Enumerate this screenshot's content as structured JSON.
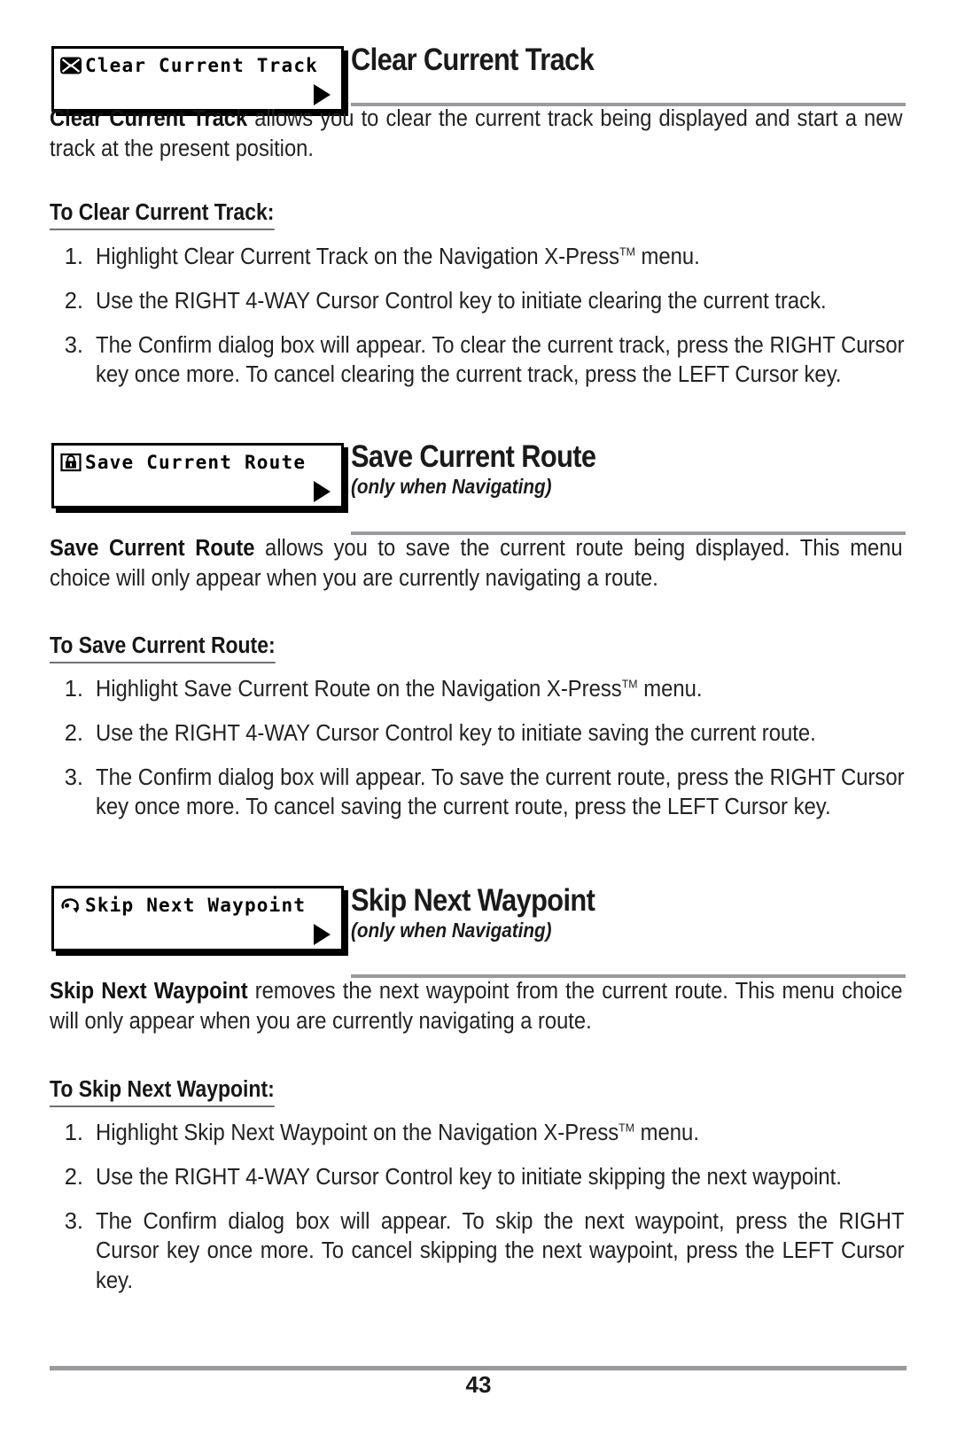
{
  "page": {
    "number": "43"
  },
  "sections": [
    {
      "id": "clear-current-track",
      "menu": {
        "label": "Clear Current Track",
        "icon": "envelope-x-icon",
        "arrow": "right-triangle-icon"
      },
      "title": "Clear Current Track",
      "subtitle": "",
      "intro_bold": "Clear Current Track",
      "intro_rest": " allows you to clear the current track being displayed and start a new track at the present position.",
      "howto_heading": "To Clear Current Track:",
      "steps": [
        {
          "num": "1.",
          "pre": "Highlight Clear Current Track on the Navigation X-Press",
          "tm": "TM",
          "post": " menu."
        },
        {
          "num": "2.",
          "pre": "Use the RIGHT 4-WAY Cursor Control key to initiate clearing the current track.",
          "tm": "",
          "post": ""
        },
        {
          "num": "3.",
          "pre": "The Confirm dialog box will appear. To clear the current track, press the RIGHT Cursor key once more. To cancel clearing the current track, press the LEFT Cursor key.",
          "tm": "",
          "post": ""
        }
      ]
    },
    {
      "id": "save-current-route",
      "menu": {
        "label": "Save Current Route",
        "icon": "padlock-icon",
        "arrow": "right-triangle-icon"
      },
      "title": "Save Current Route",
      "subtitle": "(only when Navigating)",
      "intro_bold": "Save Current Route",
      "intro_rest": " allows you to save the current route being displayed. This menu choice will only appear when you are currently navigating a route.",
      "howto_heading": "To Save Current Route:",
      "steps": [
        {
          "num": "1.",
          "pre": "Highlight Save Current Route on the Navigation X-Press",
          "tm": "TM",
          "post": " menu."
        },
        {
          "num": "2.",
          "pre": "Use the RIGHT 4-WAY Cursor Control key to initiate saving the current route.",
          "tm": "",
          "post": ""
        },
        {
          "num": "3.",
          "pre": "The Confirm dialog box will appear. To save the current route,  press the RIGHT Cursor key once more. To cancel saving the current route, press the LEFT Cursor key.",
          "tm": "",
          "post": ""
        }
      ]
    },
    {
      "id": "skip-next-waypoint",
      "menu": {
        "label": "Skip Next Waypoint",
        "icon": "curved-arrow-waypoint-icon",
        "arrow": "right-triangle-icon"
      },
      "title": "Skip Next Waypoint",
      "subtitle": "(only when Navigating)",
      "intro_bold": "Skip Next Waypoint",
      "intro_rest": " removes the next waypoint from the current route. This menu choice will only appear when you are currently navigating a route.",
      "howto_heading": "To Skip Next Waypoint:",
      "steps": [
        {
          "num": "1.",
          "pre": "Highlight Skip Next Waypoint on the Navigation X-Press",
          "tm": "TM",
          "post": " menu."
        },
        {
          "num": "2.",
          "pre": "Use the RIGHT 4-WAY Cursor Control key to initiate skipping the next waypoint.",
          "tm": "",
          "post": ""
        },
        {
          "num": "3.",
          "pre": "The Confirm dialog box will appear. To skip the next waypoint,  press the RIGHT Cursor key once more. To cancel skipping the next waypoint, press the LEFT Cursor key.",
          "tm": "",
          "post": ""
        }
      ]
    }
  ],
  "colors": {
    "rule": "#9a9a9e",
    "text": "#222222",
    "ink": "#000000"
  }
}
